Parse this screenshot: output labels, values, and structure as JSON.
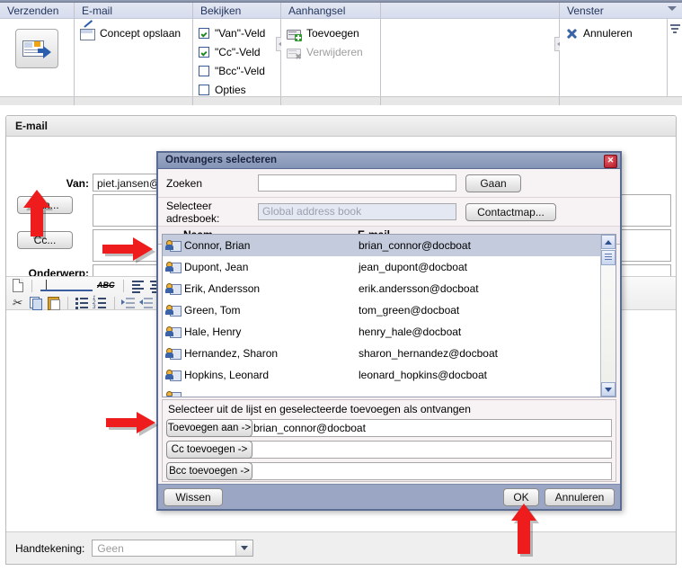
{
  "ribbon": {
    "groups": [
      {
        "title": "Verzenden",
        "icon": "send-mail-icon"
      },
      {
        "title": "E-mail",
        "items": [
          {
            "label": "Concept opslaan",
            "icon": "draft-icon"
          }
        ]
      },
      {
        "title": "Bekijken",
        "checkboxes": [
          {
            "label": "\"Van\"-Veld",
            "checked": true
          },
          {
            "label": "\"Cc\"-Veld",
            "checked": true
          },
          {
            "label": "\"Bcc\"-Veld",
            "checked": false
          },
          {
            "label": "Opties",
            "checked": false
          }
        ]
      },
      {
        "title": "Aanhangsel",
        "items": [
          {
            "label": "Toevoegen",
            "icon": "attachment-add-icon",
            "disabled": false
          },
          {
            "label": "Verwijderen",
            "icon": "attachment-remove-icon",
            "disabled": true
          }
        ]
      },
      {
        "title": "",
        "items": []
      },
      {
        "title": "Venster",
        "items": [
          {
            "label": "Annuleren",
            "icon": "cancel-x-icon"
          }
        ]
      }
    ]
  },
  "mail": {
    "panel_title": "E-mail",
    "from_label": "Van:",
    "from_value": "piet.jansen@",
    "to_button": "Aan...",
    "cc_button": "Cc...",
    "subject_label": "Onderwerp:",
    "to_value": "",
    "cc_value": "",
    "subject_value": "",
    "body_value": "",
    "signature_label": "Handtekening:",
    "signature_value": "Geen"
  },
  "dialog": {
    "title": "Ontvangers selecteren",
    "close_label": "✕",
    "search_label": "Zoeken",
    "search_value": "",
    "go_button": "Gaan",
    "addressbook_label": "Selecteer adresboek:",
    "addressbook_value": "Global address book",
    "contactmap_button": "Contactmap...",
    "columns": {
      "name": "Naam",
      "email": "E-mail"
    },
    "contacts": [
      {
        "name": "Connor, Brian",
        "email": "brian_connor@docboat",
        "selected": true
      },
      {
        "name": "Dupont, Jean",
        "email": "jean_dupont@docboat",
        "selected": false
      },
      {
        "name": "Erik, Andersson",
        "email": "erik.andersson@docboat",
        "selected": false
      },
      {
        "name": "Green, Tom",
        "email": "tom_green@docboat",
        "selected": false
      },
      {
        "name": "Hale, Henry",
        "email": "henry_hale@docboat",
        "selected": false
      },
      {
        "name": "Hernandez, Sharon",
        "email": "sharon_hernandez@docboat",
        "selected": false
      },
      {
        "name": "Hopkins, Leonard",
        "email": "leonard_hopkins@docboat",
        "selected": false
      }
    ],
    "hint": "Selecteer uit de lijst en geselecteerde toevoegen als ontvangen",
    "add_to_button": "Toevoegen aan ->",
    "add_to_value": "brian_connor@docboat",
    "add_cc_button": "Cc toevoegen ->",
    "add_cc_value": "",
    "add_bcc_button": "Bcc toevoegen ->",
    "add_bcc_value": "",
    "clear_button": "Wissen",
    "ok_button": "OK",
    "cancel_button": "Annuleren"
  },
  "colors": {
    "accent": "#5b6c93",
    "title_bar": "#8494b6",
    "footer": "#9aa6c3",
    "selection": "#c3cbdd",
    "arrow_red": "#ee1c1c",
    "ribbon_group_title": "#23355c"
  }
}
